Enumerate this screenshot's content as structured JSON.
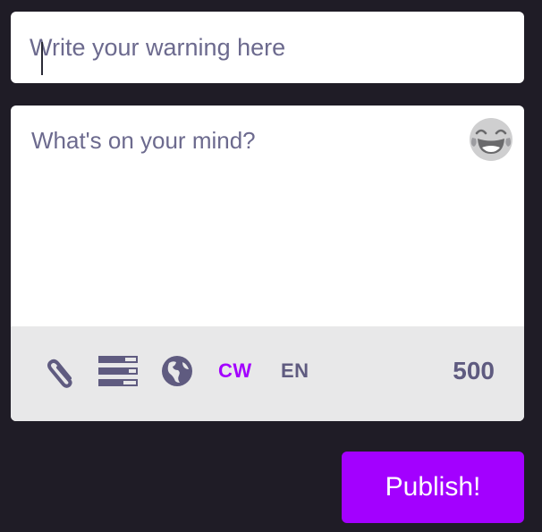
{
  "content_warning": {
    "placeholder": "Write your warning here",
    "value": ""
  },
  "compose": {
    "placeholder": "What's on your mind?",
    "value": "",
    "emoji_icon": "laughing-emoji-icon"
  },
  "toolbar": {
    "attach_icon": "paperclip-icon",
    "poll_icon": "poll-icon",
    "visibility_icon": "globe-icon",
    "cw_label": "CW",
    "language_label": "EN",
    "char_count": "500"
  },
  "publish": {
    "label": "Publish!"
  },
  "colors": {
    "background": "#1f1c26",
    "accent": "#a300ff",
    "icon": "#5f5b80",
    "toolbar_bg": "#e8e8e9",
    "placeholder": "#6c6a8e"
  }
}
